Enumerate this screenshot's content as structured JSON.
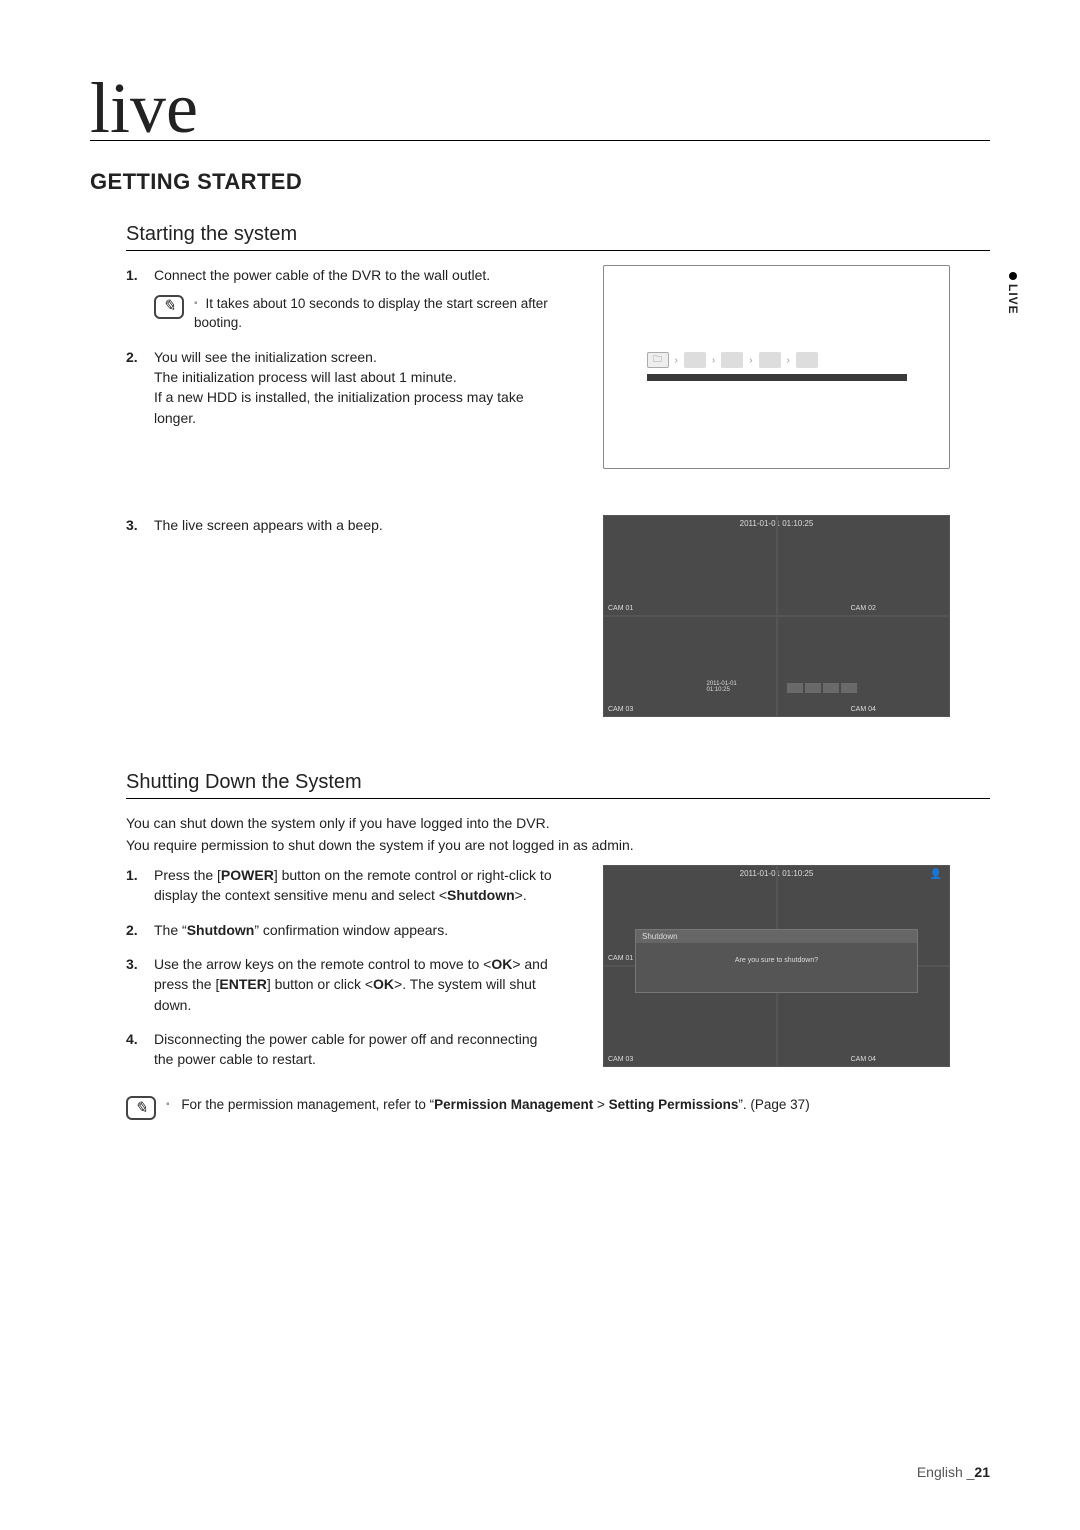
{
  "chapter_title": "live",
  "side_tab": "LIVE",
  "section_h2": "GETTING STARTED",
  "starting": {
    "heading": "Starting the system",
    "step1": "Connect the power cable of the DVR to the wall outlet.",
    "note1": "It takes about 10 seconds to display the start screen after booting.",
    "step2": "You will see the initialization screen.\nThe initialization process will last about 1 minute.\nIf a new HDD is installed, the initialization process may take longer.",
    "step3": "The live screen appears with a beep."
  },
  "shutting": {
    "heading": "Shutting Down the System",
    "intro1": "You can shut down the system only if you have logged into the DVR.",
    "intro2": "You require permission to shut down the system if you are not logged in as admin.",
    "step1_a": "Press the [",
    "step1_power": "POWER",
    "step1_b": "] button on the remote control or right-click to display the context sensitive menu and select <",
    "step1_shutdown": "Shutdown",
    "step1_c": ">.",
    "step2_a": "The “",
    "step2_shutdown": "Shutdown",
    "step2_b": "” confirmation window appears.",
    "step3_a": "Use the arrow keys on the remote control to move to <",
    "step3_ok1": "OK",
    "step3_b": "> and press the [",
    "step3_enter": "ENTER",
    "step3_c": "] button or click <",
    "step3_ok2": "OK",
    "step3_d": ">. The system will shut down.",
    "step4": "Disconnecting the power cable for power off and reconnecting the power cable to restart.",
    "note2_a": "For the permission management, refer to “",
    "note2_perm": "Permission Management",
    "note2_gt": " > ",
    "note2_set": "Setting Permissions",
    "note2_b": "”. (Page 37)"
  },
  "dvr": {
    "timestamp": "2011-01-01 01:10:25",
    "cam1": "CAM 01",
    "cam2": "CAM 02",
    "cam3": "CAM 03",
    "cam4": "CAM 04",
    "small_ts": "2011-01-01\n01:10:25",
    "modal_title": "Shutdown",
    "modal_body": "Are you sure to shutdown?"
  },
  "footer": {
    "lang": "English _",
    "page": "21"
  }
}
